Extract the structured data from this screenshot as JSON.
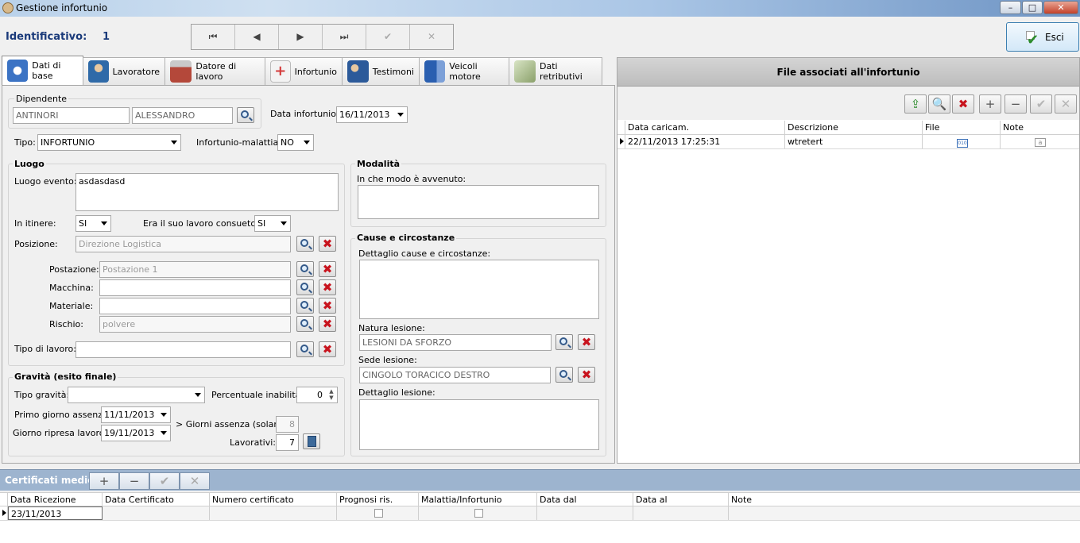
{
  "window": {
    "title": "Gestione infortunio",
    "min": "–",
    "max": "□",
    "close": "✕"
  },
  "header": {
    "id_label": "Identificativo:",
    "id_value": "1",
    "nav": {
      "first": "⏮",
      "prev": "◀",
      "next": "▶",
      "last": "⏭",
      "confirm": "✔",
      "cancel": "✕"
    },
    "exit_label": "Esci"
  },
  "tabs": [
    {
      "label": "Dati di base",
      "icon": "info-icon",
      "color": "#3b73c4"
    },
    {
      "label": "Lavoratore",
      "icon": "worker-icon",
      "color": "#2f6aa8"
    },
    {
      "label": "Datore di lavoro",
      "icon": "factory-icon",
      "color": "#b4483a"
    },
    {
      "label": "Infortunio",
      "icon": "first-aid-icon",
      "color": "#d43a3a"
    },
    {
      "label": "Testimoni",
      "icon": "people-icon",
      "color": "#2c5a9a"
    },
    {
      "label": "Veicoli motore",
      "icon": "truck-icon",
      "color": "#2a5fb0"
    },
    {
      "label": "Dati retributivi",
      "icon": "money-icon",
      "color": "#8aa06a"
    }
  ],
  "base": {
    "dipendente_label": "Dipendente",
    "cognome": "ANTINORI",
    "nome": "ALESSANDRO",
    "data_inf_label": "Data infortunio:",
    "data_inf": "16/11/2013",
    "tipo_label": "Tipo:",
    "tipo": "INFORTUNIO",
    "inf_mal_label": "Infortunio-malattia:",
    "inf_mal": "NO"
  },
  "luogo": {
    "title": "Luogo",
    "evento_label": "Luogo evento:",
    "evento": "asdasdasd",
    "itinere_label": "In itinere:",
    "itinere": "SI",
    "consueto_label": "Era il suo lavoro consueto ?:",
    "consueto": "SI",
    "posizione_label": "Posizione:",
    "posizione": "Direzione Logistica",
    "postazione_label": "Postazione:",
    "postazione": "Postazione 1",
    "macchina_label": "Macchina:",
    "macchina": "",
    "materiale_label": "Materiale:",
    "materiale": "",
    "rischio_label": "Rischio:",
    "rischio": "polvere",
    "tipo_lavoro_label": "Tipo di lavoro:",
    "tipo_lavoro": ""
  },
  "gravita": {
    "title": "Gravità (esito finale)",
    "tipo_label": "Tipo gravità:",
    "tipo": "",
    "perc_label": "Percentuale inabilità:",
    "perc": "0",
    "primo_label": "Primo giorno assenza:",
    "primo": "11/11/2013",
    "ripresa_label": "Giorno ripresa lavoro:",
    "ripresa": "19/11/2013",
    "giorni_label": "> Giorni assenza (solari):",
    "giorni": "8",
    "lavorativi_label": "Lavorativi:",
    "lavorativi": "7"
  },
  "modalita": {
    "title": "Modalità",
    "modo_label": "In che modo è avvenuto:",
    "modo": ""
  },
  "cause": {
    "title": "Cause e circostanze",
    "dettaglio_label": "Dettaglio cause e circostanze:",
    "dettaglio": "",
    "natura_label": "Natura lesione:",
    "natura": "LESIONI DA SFORZO",
    "sede_label": "Sede lesione:",
    "sede": "CINGOLO TORACICO DESTRO",
    "det_lesione_label": "Dettaglio lesione:",
    "det_lesione": ""
  },
  "files": {
    "title": "File associati all'infortunio",
    "columns": [
      "Data caricam.",
      "Descrizione",
      "File",
      "Note"
    ],
    "rows": [
      {
        "data": "22/11/2013 17:25:31",
        "descrizione": "wtretert",
        "file_icon": "file-binary-icon",
        "note_icon": "note-icon"
      }
    ],
    "toolbar": {
      "add": "+",
      "remove": "−",
      "confirm": "✔",
      "cancel": "✕"
    }
  },
  "certificati": {
    "title": "Certificati medici",
    "toolbar": {
      "add": "+",
      "remove": "−",
      "confirm": "✔",
      "cancel": "✕"
    },
    "columns": [
      "Data Ricezione",
      "Data Certificato",
      "Numero certificato",
      "Prognosi ris.",
      "Malattia/Infortunio",
      "Data dal",
      "Data al",
      "Note"
    ],
    "rows": [
      {
        "data_ricezione": "23/11/2013",
        "data_certificato": "",
        "numero": "",
        "data_dal": "",
        "data_al": "",
        "note": ""
      }
    ]
  }
}
